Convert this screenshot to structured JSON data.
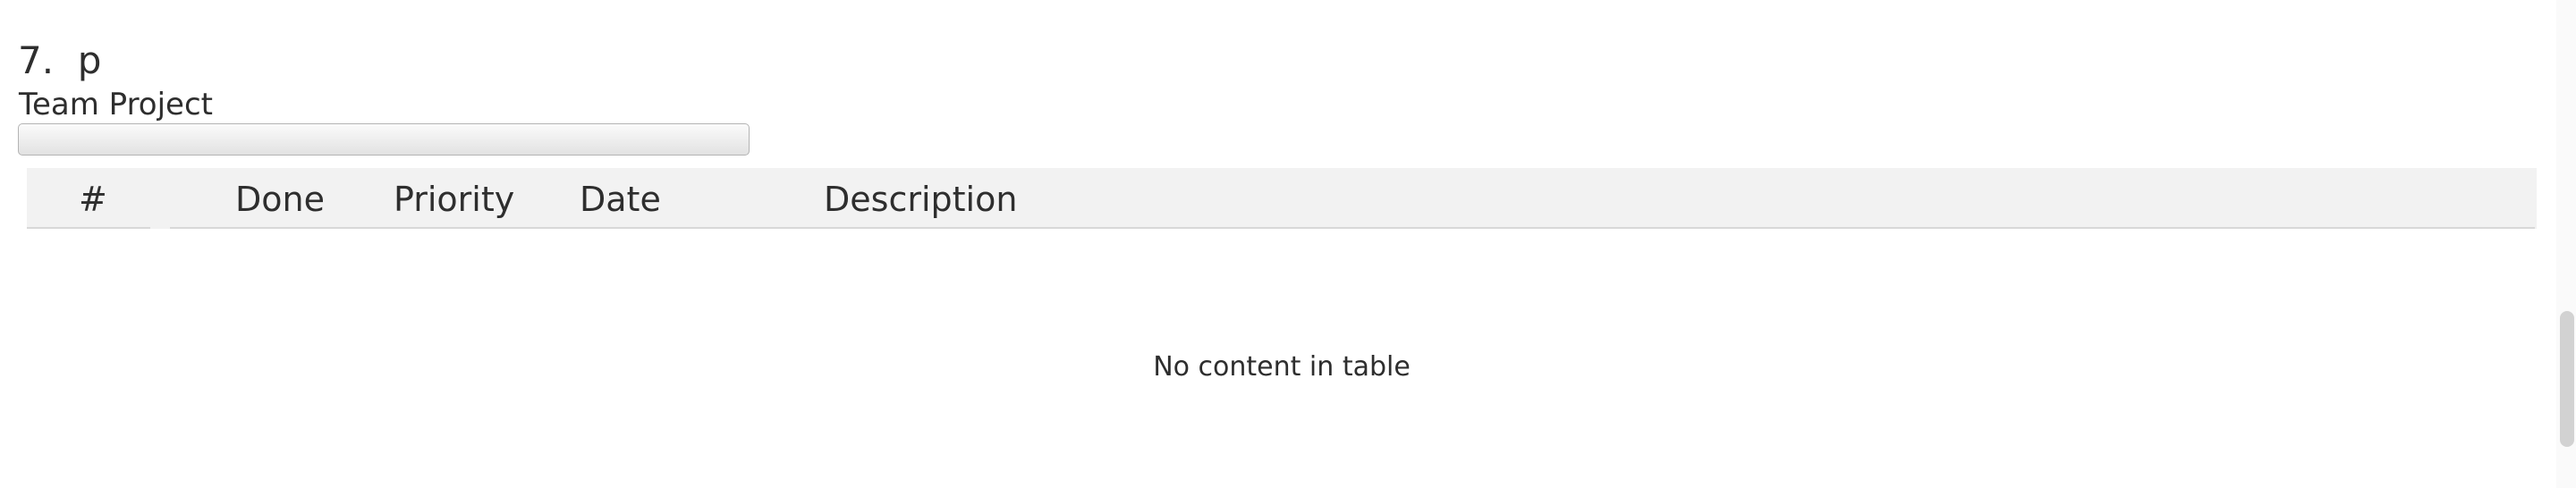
{
  "heading": {
    "number": "7.",
    "letter": "p"
  },
  "project": {
    "name": "Team Project",
    "progress_fraction": 0
  },
  "table": {
    "columns": [
      "#",
      "Done",
      "Priority",
      "Date",
      "Description",
      ""
    ],
    "empty_message": "No content in table"
  }
}
